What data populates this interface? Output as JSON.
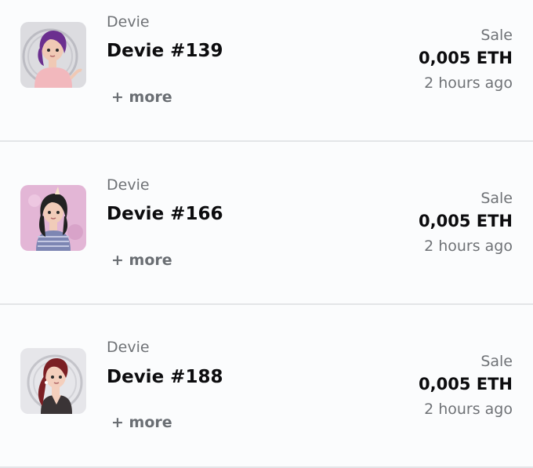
{
  "activity": [
    {
      "collection": "Devie",
      "name": "Devie #139",
      "more": "+ more",
      "event": "Sale",
      "price": "0,005 ETH",
      "time": "2 hours ago",
      "avatar": {
        "bg": "#d9d9de",
        "hair": "#6b2f8f",
        "shirt": "#f2b8bd",
        "skin": "#f0c9b5"
      }
    },
    {
      "collection": "Devie",
      "name": "Devie #166",
      "more": "+ more",
      "event": "Sale",
      "price": "0,005 ETH",
      "time": "2 hours ago",
      "avatar": {
        "bg": "#e3b6d6",
        "hair": "#222222",
        "shirt": "#7d86b3",
        "skin": "#f1ccb9"
      }
    },
    {
      "collection": "Devie",
      "name": "Devie #188",
      "more": "+ more",
      "event": "Sale",
      "price": "0,005 ETH",
      "time": "2 hours ago",
      "avatar": {
        "bg": "#e6e6ea",
        "hair": "#7b1f24",
        "shirt": "#3a3436",
        "skin": "#f4cfbd"
      }
    }
  ]
}
